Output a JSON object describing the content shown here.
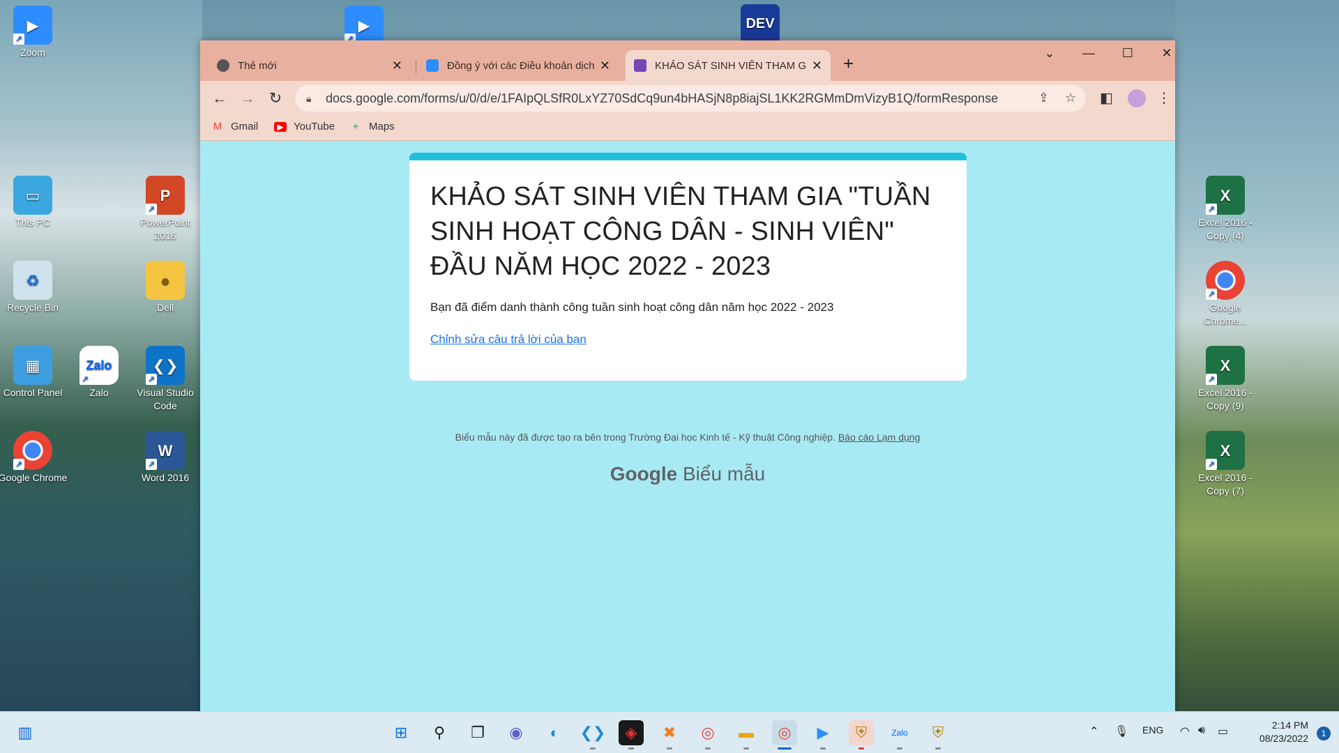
{
  "desktop": {
    "icons": [
      {
        "label": "Zoom"
      },
      {
        "label": "This PC"
      },
      {
        "label": "Recycle Bin"
      },
      {
        "label": "Control Panel"
      },
      {
        "label": "Google Chrome"
      },
      {
        "label": "PowerPoint 2016"
      },
      {
        "label": "Dell"
      },
      {
        "label": "Zalo"
      },
      {
        "label": "Visual Studio Code"
      },
      {
        "label": "Word 2016"
      },
      {
        "label": "Excel 2016 - Copy (4)"
      },
      {
        "label": "Google Chrome..."
      },
      {
        "label": "Excel 2016 - Copy (9)"
      },
      {
        "label": "Excel 2016 - Copy (7)"
      }
    ],
    "dev_icon_text": "DEV"
  },
  "browser": {
    "tabs": [
      {
        "title": "Thẻ mới",
        "icon": "globe-icon"
      },
      {
        "title": "Đồng ý với các Điều khoản dịch v",
        "icon": "zoom-icon"
      },
      {
        "title": "KHẢO SÁT SINH VIÊN THAM GIA",
        "icon": "forms-icon"
      }
    ],
    "url": "docs.google.com/forms/u/0/d/e/1FAIpQLSfR0LxYZ70SdCq9un4bHASjN8p8iajSL1KK2RGMmDmVizyB1Q/formResponse",
    "bookmarks": [
      {
        "label": "Gmail",
        "color": "#ea4335"
      },
      {
        "label": "YouTube",
        "color": "#ff0000"
      },
      {
        "label": "Maps",
        "color": "#34a853"
      }
    ]
  },
  "form": {
    "accent": "#1ebfd9",
    "title": "KHẢO SÁT SINH VIÊN THAM GIA \"TUẦN SINH HOẠT CÔNG DÂN - SINH VIÊN\" ĐẦU NĂM HỌC 2022 - 2023",
    "message": "Bạn đã điểm danh thành công tuần sinh hoạt công dân năm học 2022 - 2023",
    "edit_link": "Chỉnh sửa câu trả lời của bạn",
    "footer_text": "Biểu mẫu này đã được tạo ra bên trong Trường Đại học Kinh tế - Kỹ thuật Công nghiệp.",
    "report_link": "Báo cáo Lạm dụng",
    "brand_google": "Google",
    "brand_forms": "Biểu mẫu"
  },
  "taskbar": {
    "language": "ENG",
    "time": "2:14 PM",
    "date": "08/23/2022",
    "notification_count": "1"
  }
}
